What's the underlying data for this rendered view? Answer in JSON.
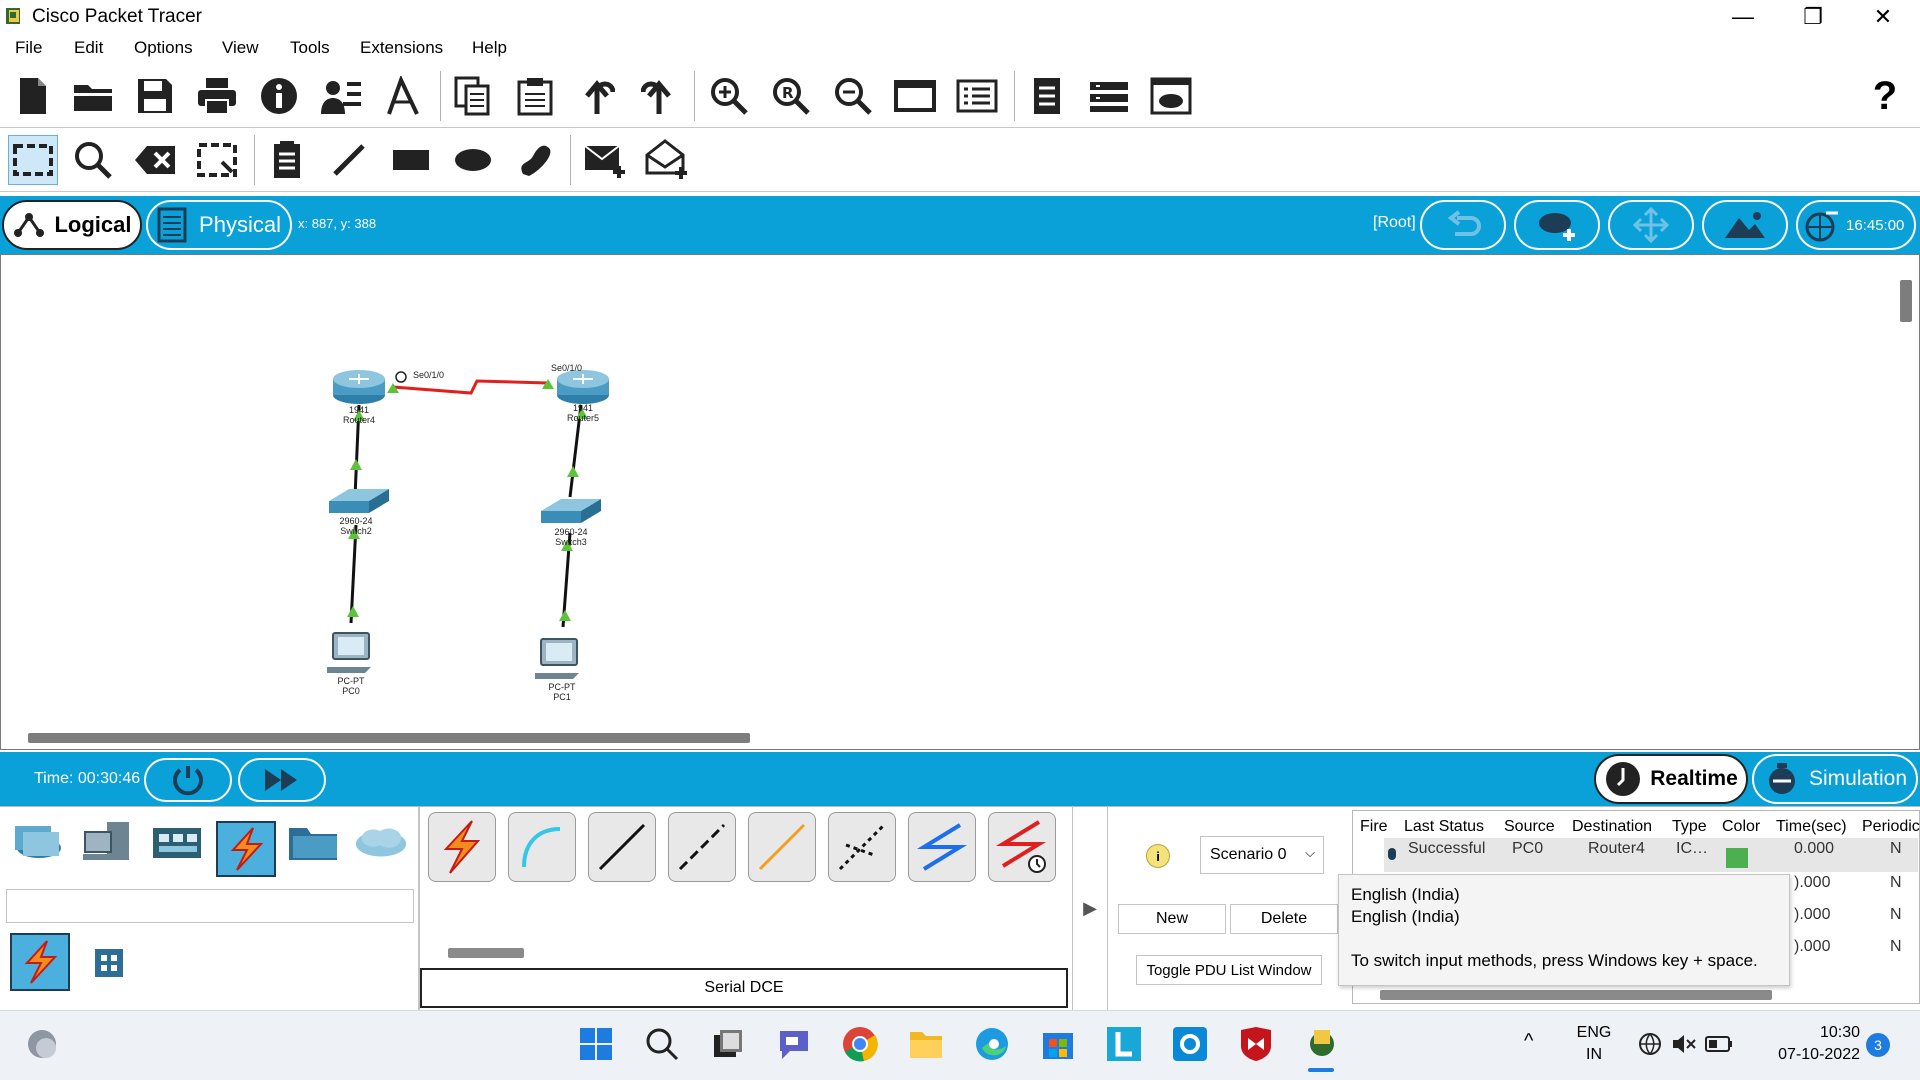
{
  "window": {
    "title": "Cisco Packet Tracer",
    "minimize_glyph": "—",
    "maximize_glyph": "❐",
    "close_glyph": "✕"
  },
  "menu": [
    "File",
    "Edit",
    "Options",
    "View",
    "Tools",
    "Extensions",
    "Help"
  ],
  "toolbar_help_glyph": "?",
  "modebar": {
    "logical_label": "Logical",
    "physical_label": "Physical",
    "coords": "x: 887, y: 388",
    "root_label": "[Root]",
    "clock": "16:45:00"
  },
  "topology": {
    "router4": {
      "model": "1941",
      "name": "Router4",
      "port": "Se0/1/0"
    },
    "router5": {
      "model": "1941",
      "name": "Router5",
      "port": "Se0/1/0"
    },
    "switch2": {
      "model": "2960-24",
      "name": "Switch2"
    },
    "switch3": {
      "model": "2960-24",
      "name": "Switch3"
    },
    "pc0": {
      "model": "PC-PT",
      "name": "PC0"
    },
    "pc1": {
      "model": "PC-PT",
      "name": "PC1"
    }
  },
  "timebar": {
    "time": "Time: 00:30:46",
    "realtime_label": "Realtime",
    "simulation_label": "Simulation"
  },
  "bottom": {
    "selected_connection": "Serial DCE",
    "scenario": "Scenario 0",
    "new_label": "New",
    "delete_label": "Delete",
    "toggle_label": "Toggle PDU List Window",
    "expand_glyph": "▶"
  },
  "pdu_table": {
    "headers": [
      "Fire",
      "Last Status",
      "Source",
      "Destination",
      "Type",
      "Color",
      "Time(sec)",
      "Periodic"
    ],
    "row": {
      "last_status": "Successful",
      "source": "PC0",
      "destination": "Router4",
      "type": "IC…",
      "time": "0.000",
      "periodic": "N",
      "color": "#4caf50"
    },
    "extra_times": [
      ").000",
      ").000",
      ").000"
    ],
    "extra_periodic": [
      "N",
      "N",
      "N"
    ]
  },
  "tooltip": {
    "line1": "English (India)",
    "line2": "English (India)",
    "line3": "To switch input methods, press Windows key + space."
  },
  "taskbar": {
    "lang_top": "ENG",
    "lang_bottom": "IN",
    "time": "10:30",
    "date": "07-10-2022",
    "notification_count": "3",
    "chevron": "^"
  },
  "colors": {
    "accent_blue": "#0aa0d8",
    "serial_link": "#e0201e",
    "link_up": "#5cc33a"
  }
}
